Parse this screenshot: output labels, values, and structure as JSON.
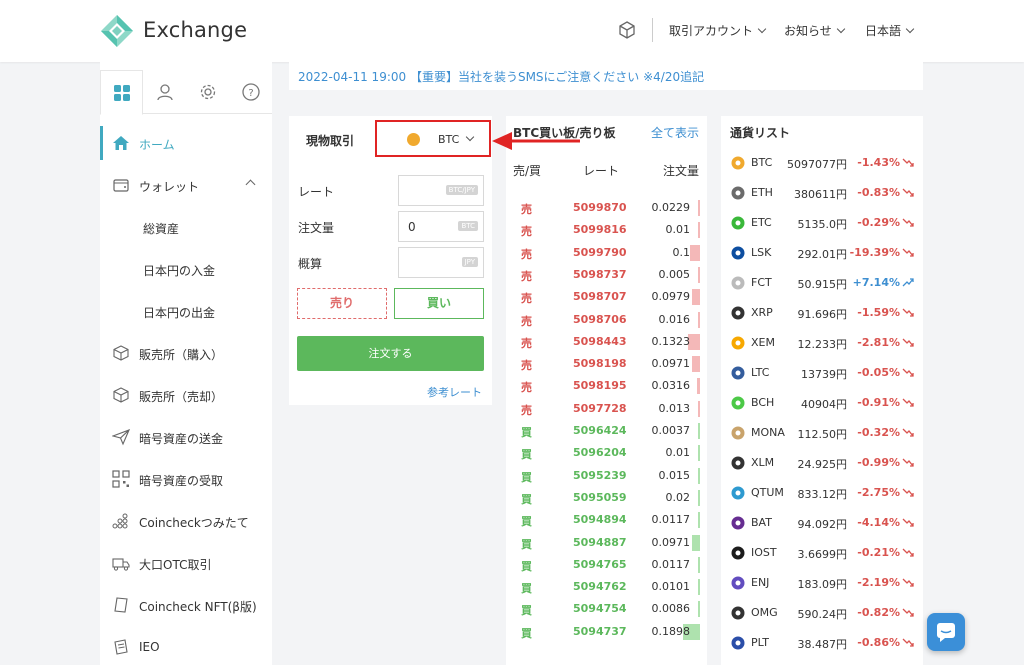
{
  "header": {
    "logo_text": "Exchange",
    "menus": [
      {
        "label": "取引アカウント"
      },
      {
        "label": "お知らせ"
      },
      {
        "label": "日本語"
      }
    ]
  },
  "sidebar": {
    "tabs": [
      "grid-icon",
      "user-icon",
      "gear-icon",
      "help-icon"
    ],
    "items": [
      {
        "label": "ホーム",
        "icon": "home-icon",
        "active": true
      },
      {
        "label": "ウォレット",
        "icon": "wallet-icon"
      },
      {
        "label": "総資産",
        "sub": true
      },
      {
        "label": "日本円の入金",
        "sub": true
      },
      {
        "label": "日本円の出金",
        "sub": true
      },
      {
        "label": "販売所（購入）",
        "icon": "cube-icon"
      },
      {
        "label": "販売所（売却）",
        "icon": "cube-icon"
      },
      {
        "label": "暗号資産の送金",
        "icon": "send-icon"
      },
      {
        "label": "暗号資産の受取",
        "icon": "qr-icon"
      },
      {
        "label": "Coincheckつみたて",
        "icon": "stack-icon"
      },
      {
        "label": "大口OTC取引",
        "icon": "truck-icon"
      },
      {
        "label": "Coincheck NFT(β版)",
        "icon": "nft-icon"
      },
      {
        "label": "IEO",
        "icon": "ieo-icon"
      }
    ]
  },
  "notice": {
    "text": "2022-04-11 19:00 【重要】当社を装うSMSにご注意ください ※4/20追記"
  },
  "trade": {
    "title": "現物取引",
    "coin": "BTC",
    "rate_label": "レート",
    "rate_unit": "BTC/JPY",
    "amount_label": "注文量",
    "amount_value": "0",
    "amount_unit": "BTC",
    "estimate_label": "概算",
    "estimate_unit": "JPY",
    "sell_label": "売り",
    "buy_label": "買い",
    "order_label": "注文する",
    "reference_link": "参考レート"
  },
  "orderbook": {
    "title": "BTC買い板/売り板",
    "show_all": "全て表示",
    "col_side": "売/買",
    "col_rate": "レート",
    "col_qty": "注文量",
    "rows": [
      {
        "side": "売",
        "type": "sell",
        "rate": "5099870",
        "qty": "0.0229",
        "bar": 0.04
      },
      {
        "side": "売",
        "type": "sell",
        "rate": "5099816",
        "qty": "0.01",
        "bar": 0.01
      },
      {
        "side": "売",
        "type": "sell",
        "rate": "5099790",
        "qty": "0.1",
        "bar": 0.16
      },
      {
        "side": "売",
        "type": "sell",
        "rate": "5098737",
        "qty": "0.005",
        "bar": 0.01
      },
      {
        "side": "売",
        "type": "sell",
        "rate": "5098707",
        "qty": "0.0979",
        "bar": 0.14
      },
      {
        "side": "売",
        "type": "sell",
        "rate": "5098706",
        "qty": "0.016",
        "bar": 0.02
      },
      {
        "side": "売",
        "type": "sell",
        "rate": "5098443",
        "qty": "0.1323",
        "bar": 0.2
      },
      {
        "side": "売",
        "type": "sell",
        "rate": "5098198",
        "qty": "0.0971",
        "bar": 0.14
      },
      {
        "side": "売",
        "type": "sell",
        "rate": "5098195",
        "qty": "0.0316",
        "bar": 0.05
      },
      {
        "side": "売",
        "type": "sell",
        "rate": "5097728",
        "qty": "0.013",
        "bar": 0.02
      },
      {
        "side": "買",
        "type": "buy",
        "rate": "5096424",
        "qty": "0.0037",
        "bar": 0.01
      },
      {
        "side": "買",
        "type": "buy",
        "rate": "5096204",
        "qty": "0.01",
        "bar": 0.01
      },
      {
        "side": "買",
        "type": "buy",
        "rate": "5095239",
        "qty": "0.015",
        "bar": 0.02
      },
      {
        "side": "買",
        "type": "buy",
        "rate": "5095059",
        "qty": "0.02",
        "bar": 0.03
      },
      {
        "side": "買",
        "type": "buy",
        "rate": "5094894",
        "qty": "0.0117",
        "bar": 0.02
      },
      {
        "side": "買",
        "type": "buy",
        "rate": "5094887",
        "qty": "0.0971",
        "bar": 0.14
      },
      {
        "side": "買",
        "type": "buy",
        "rate": "5094765",
        "qty": "0.0117",
        "bar": 0.02
      },
      {
        "side": "買",
        "type": "buy",
        "rate": "5094762",
        "qty": "0.0101",
        "bar": 0.01
      },
      {
        "side": "買",
        "type": "buy",
        "rate": "5094754",
        "qty": "0.0086",
        "bar": 0.01
      },
      {
        "side": "買",
        "type": "buy",
        "rate": "5094737",
        "qty": "0.1898",
        "bar": 0.28
      }
    ]
  },
  "currency_list": {
    "title": "通貨リスト",
    "rows": [
      {
        "symbol": "BTC",
        "price": "5097077円",
        "change": "-1.43%",
        "dir": "down",
        "icon": "btc-icon",
        "color": "#f0a92e"
      },
      {
        "symbol": "ETH",
        "price": "380611円",
        "change": "-0.83%",
        "dir": "down",
        "icon": "eth-icon",
        "color": "#6b6b6b"
      },
      {
        "symbol": "ETC",
        "price": "5135.0円",
        "change": "-0.29%",
        "dir": "down",
        "icon": "etc-icon",
        "color": "#3ab83a"
      },
      {
        "symbol": "LSK",
        "price": "292.01円",
        "change": "-19.39%",
        "dir": "down",
        "icon": "lsk-icon",
        "color": "#0d4ea0"
      },
      {
        "symbol": "FCT",
        "price": "50.915円",
        "change": "+7.14%",
        "dir": "up",
        "icon": "fct-icon",
        "color": "#bbbbbb"
      },
      {
        "symbol": "XRP",
        "price": "91.696円",
        "change": "-1.59%",
        "dir": "down",
        "icon": "xrp-icon",
        "color": "#333333"
      },
      {
        "symbol": "XEM",
        "price": "12.233円",
        "change": "-2.81%",
        "dir": "down",
        "icon": "xem-icon",
        "color": "#f7a800"
      },
      {
        "symbol": "LTC",
        "price": "13739円",
        "change": "-0.05%",
        "dir": "down",
        "icon": "ltc-icon",
        "color": "#345d9d"
      },
      {
        "symbol": "BCH",
        "price": "40904円",
        "change": "-0.91%",
        "dir": "down",
        "icon": "bch-icon",
        "color": "#4cc947"
      },
      {
        "symbol": "MONA",
        "price": "112.50円",
        "change": "-0.32%",
        "dir": "down",
        "icon": "mona-icon",
        "color": "#c9a36b"
      },
      {
        "symbol": "XLM",
        "price": "24.925円",
        "change": "-0.99%",
        "dir": "down",
        "icon": "xlm-icon",
        "color": "#333333"
      },
      {
        "symbol": "QTUM",
        "price": "833.12円",
        "change": "-2.75%",
        "dir": "down",
        "icon": "qtum-icon",
        "color": "#2e9ad0"
      },
      {
        "symbol": "BAT",
        "price": "94.092円",
        "change": "-4.14%",
        "dir": "down",
        "icon": "bat-icon",
        "color": "#662d91"
      },
      {
        "symbol": "IOST",
        "price": "3.6699円",
        "change": "-0.21%",
        "dir": "down",
        "icon": "iost-icon",
        "color": "#1c1c1c"
      },
      {
        "symbol": "ENJ",
        "price": "183.09円",
        "change": "-2.19%",
        "dir": "down",
        "icon": "enj-icon",
        "color": "#624dbf"
      },
      {
        "symbol": "OMG",
        "price": "590.24円",
        "change": "-0.82%",
        "dir": "down",
        "icon": "omg-icon",
        "color": "#333333"
      },
      {
        "symbol": "PLT",
        "price": "38.487円",
        "change": "-0.86%",
        "dir": "down",
        "icon": "plt-icon",
        "color": "#2b4ea8"
      }
    ]
  },
  "colors": {
    "accent": "#40a9c0",
    "sell": "#d9534f",
    "buy": "#5cb85c",
    "link": "#3e8fd1"
  }
}
